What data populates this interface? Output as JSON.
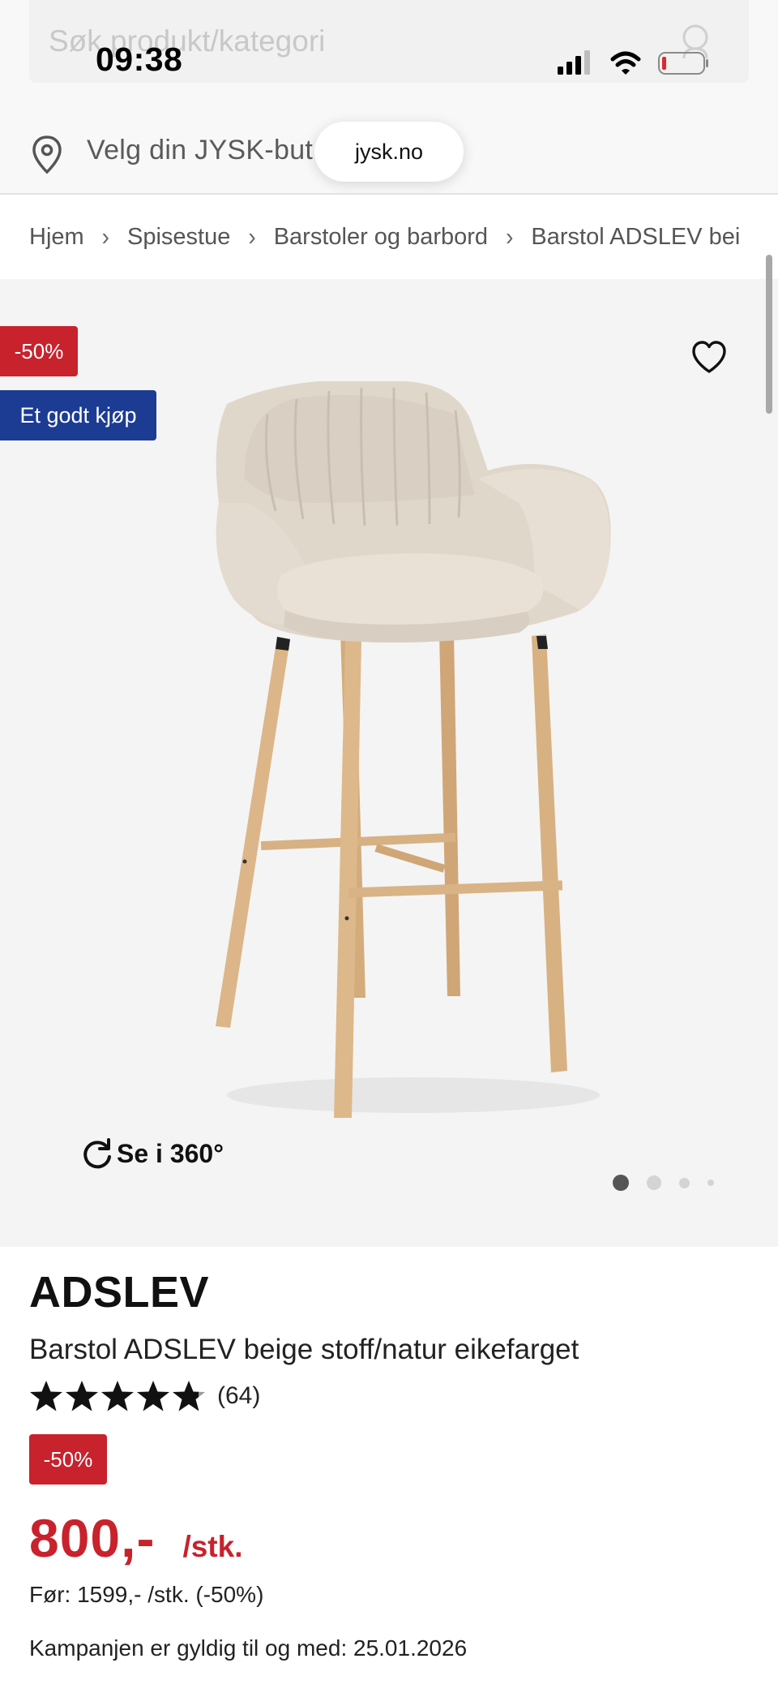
{
  "status_bar": {
    "time": "09:38"
  },
  "search": {
    "placeholder": "Søk produkt/kategori"
  },
  "store_selector": {
    "label": "Velg din JYSK-butikk"
  },
  "browser": {
    "url": "jysk.no"
  },
  "breadcrumb": [
    "Hjem",
    "Spisestue",
    "Barstoler og barbord",
    "Barstol ADSLEV bei"
  ],
  "badges": {
    "discount": "-50%",
    "deal": "Et godt kjøp"
  },
  "gallery": {
    "view_360_label": "Se i 360°",
    "dot_count": 4,
    "active_dot": 0
  },
  "product": {
    "brand": "ADSLEV",
    "name": "Barstol ADSLEV beige stoff/natur eikefarget",
    "rating": 4.8,
    "review_count": "(64)",
    "discount_badge": "-50%",
    "price": "800,-",
    "price_unit": "/stk.",
    "before_price": "Før: 1599,- /stk. (-50%)",
    "campaign_text": "Kampanjen er gyldig til og med: 25.01.2026"
  },
  "colors": {
    "sale_red": "#c8222d",
    "deal_blue": "#1c3c93",
    "image_bg": "#f4f4f4"
  }
}
